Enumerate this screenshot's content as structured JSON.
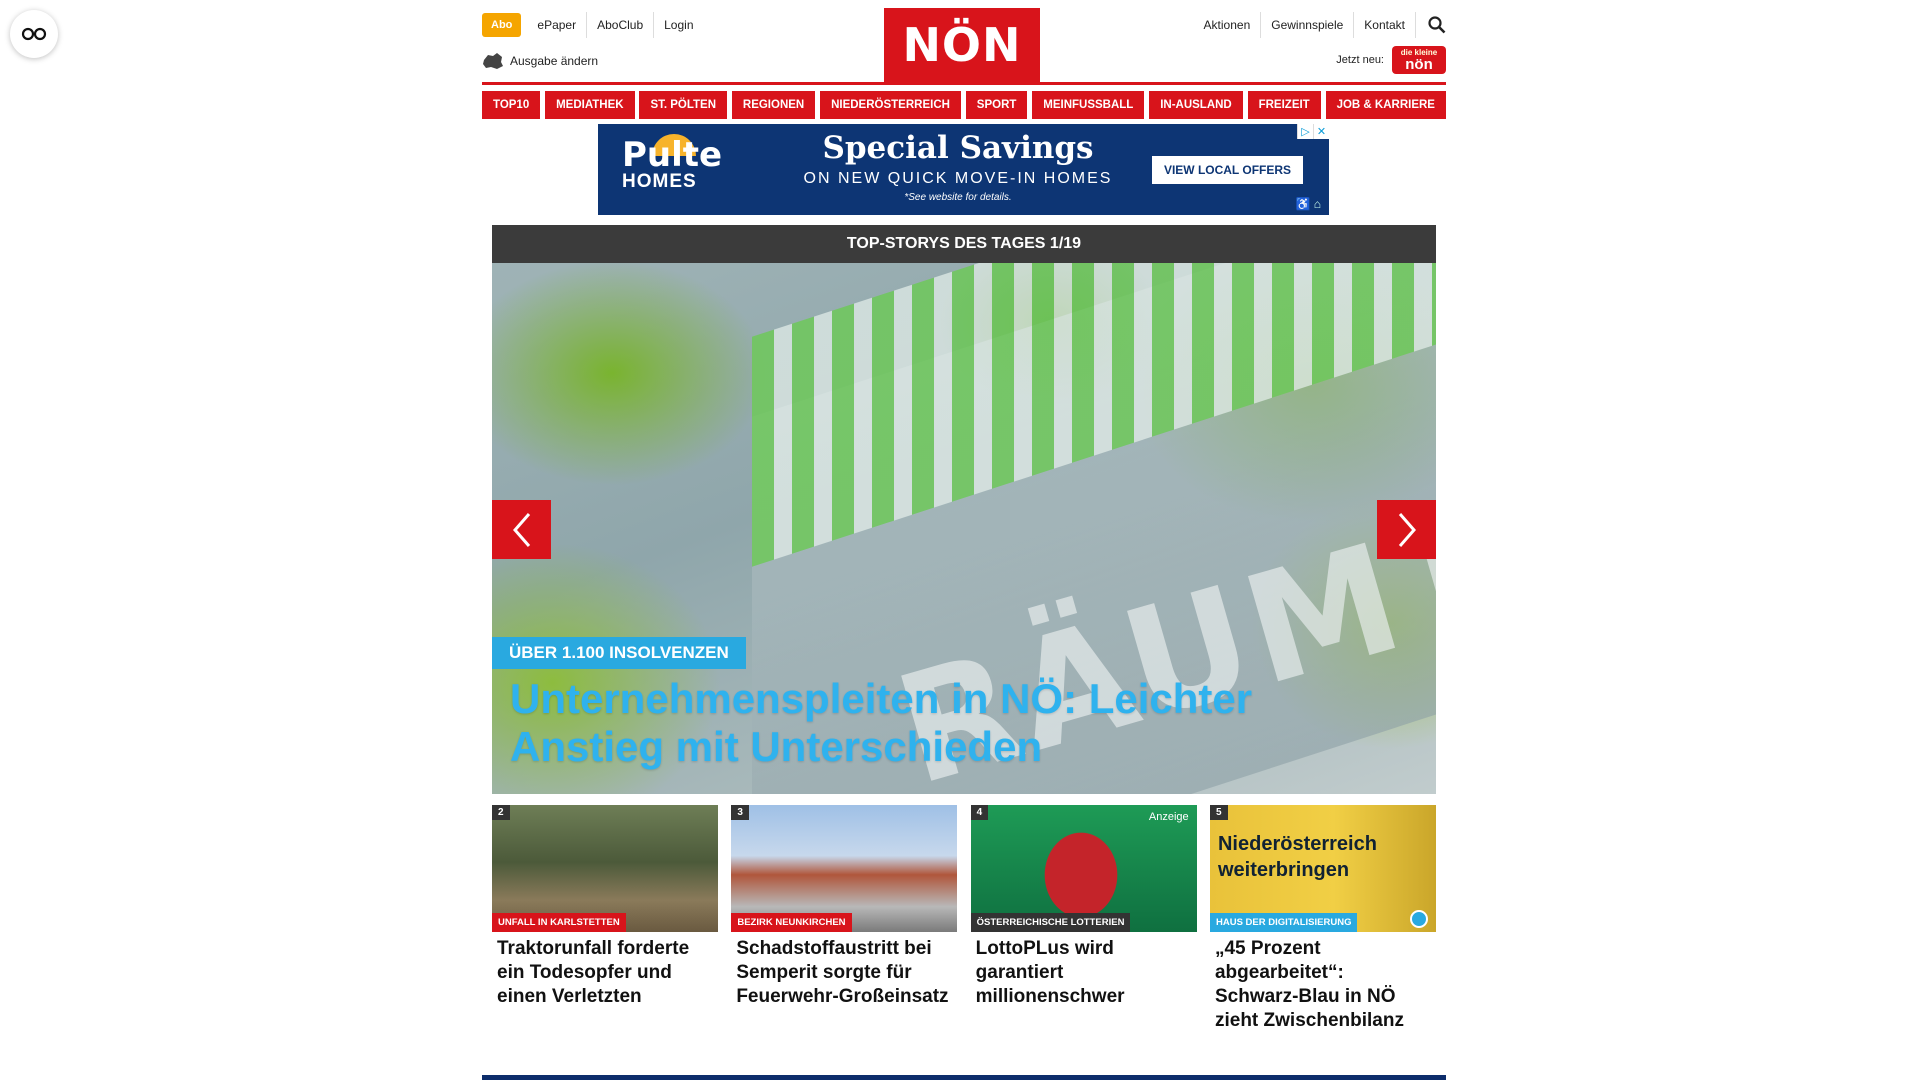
{
  "accessibility": {
    "icon": "glasses-icon"
  },
  "header": {
    "abo": "Abo",
    "left_links": [
      "ePaper",
      "AboClub",
      "Login"
    ],
    "edition": "Ausgabe ändern",
    "logo": "NÖN",
    "right_links": [
      "Aktionen",
      "Gewinnspiele",
      "Kontakt"
    ],
    "jetzt_neu": "Jetzt neu:",
    "badge_small": "die kleine",
    "badge_big": "nön"
  },
  "nav": [
    "TOP10",
    "MEDIATHEK",
    "ST. PÖLTEN",
    "REGIONEN",
    "NIEDERÖSTERREICH",
    "SPORT",
    "MEINFUSSBALL",
    "IN-AUSLAND",
    "FREIZEIT",
    "JOB & KARRIERE"
  ],
  "ad": {
    "brand_top": "Pulte",
    "brand_bottom": "HOMES",
    "headline": "Special Savings",
    "subline": "ON NEW QUICK MOVE-IN HOMES",
    "disclaimer": "*See website for details.",
    "cta": "VIEW LOCAL OFFERS"
  },
  "hero": {
    "section_title": "TOP-STORYS DES TAGES 1/19",
    "image_text": "RÄUMT",
    "kicker": "ÜBER 1.100 INSOLVENZEN",
    "headline": "Unternehmenspleiten in NÖ: Leichter Anstieg mit Unterschieden"
  },
  "teasers": [
    {
      "num": "2",
      "tag": "UNFALL IN KARLSTETTEN",
      "title": "Traktorunfall forderte ein Todesopfer und einen Verletzten"
    },
    {
      "num": "3",
      "tag": "BEZIRK NEUNKIRCHEN",
      "title": "Schadstoffaustritt bei Semperit sorgte für Feuerwehr-Großeinsatz"
    },
    {
      "num": "4",
      "tag": "ÖSTERREICHISCHE LOTTERIEN",
      "ad_label": "Anzeige",
      "title": "LottoPLus wird garantiert millionenschwer"
    },
    {
      "num": "5",
      "tag": "HAUS DER DIGITALISIERUNG",
      "image_text": "Niederösterreich weiterbringen",
      "title": "„45 Prozent abgearbeitet“: Schwarz-Blau in NÖ zieht Zwischenbilanz"
    }
  ]
}
